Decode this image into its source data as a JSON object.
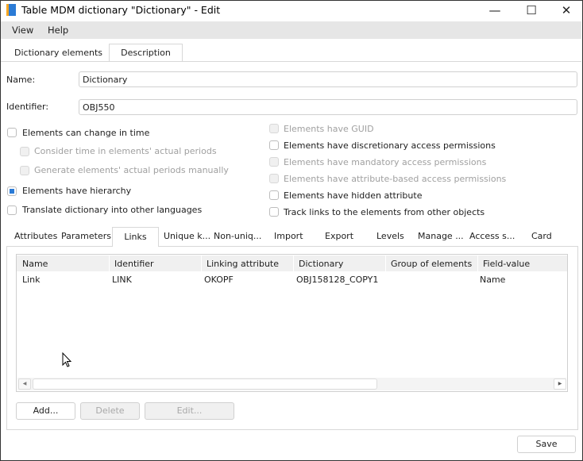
{
  "window": {
    "title": "Table MDM dictionary \"Dictionary\" - Edit",
    "minimize": "—",
    "maximize": "☐",
    "close": "✕"
  },
  "menu": [
    "View",
    "Help"
  ],
  "top_tabs": [
    "Dictionary elements",
    "Description"
  ],
  "form": {
    "name_label": "Name:",
    "name_value": "Dictionary",
    "identifier_label": "Identifier:",
    "identifier_value": "OBJ550"
  },
  "left_checks": [
    {
      "label": "Elements can change in time",
      "checked": false,
      "disabled": false
    },
    {
      "label": "Consider time in elements' actual periods",
      "checked": false,
      "disabled": true
    },
    {
      "label": "Generate elements' actual periods manually",
      "checked": false,
      "disabled": true
    },
    {
      "label": "Elements have hierarchy",
      "checked": true,
      "disabled": false
    },
    {
      "label": "Translate dictionary into other languages",
      "checked": false,
      "disabled": false
    }
  ],
  "right_checks": [
    {
      "label": "Elements have GUID",
      "checked": false,
      "disabled": true
    },
    {
      "label": "Elements have discretionary access permissions",
      "checked": false,
      "disabled": false
    },
    {
      "label": "Elements have mandatory access permissions",
      "checked": false,
      "disabled": true
    },
    {
      "label": "Elements have attribute-based access permissions",
      "checked": false,
      "disabled": true
    },
    {
      "label": "Elements have hidden attribute",
      "checked": false,
      "disabled": false
    },
    {
      "label": "Track links to the elements from other objects",
      "checked": false,
      "disabled": false
    }
  ],
  "sub_tabs": [
    "Attributes",
    "Parameters",
    "Links",
    "Unique k...",
    "Non-uniq...",
    "Import",
    "Export",
    "Levels",
    "Manage ...",
    "Access s...",
    "Card"
  ],
  "active_sub_tab": "Links",
  "table": {
    "columns": [
      "Name",
      "Identifier",
      "Linking attribute",
      "Dictionary",
      "Group of elements",
      "Field-value"
    ],
    "rows": [
      [
        "Link",
        "LINK",
        "OKOPF",
        "OBJ158128_COPY1",
        "",
        "Name"
      ]
    ]
  },
  "buttons": {
    "add": "Add...",
    "delete": "Delete",
    "edit": "Edit...",
    "save": "Save"
  }
}
